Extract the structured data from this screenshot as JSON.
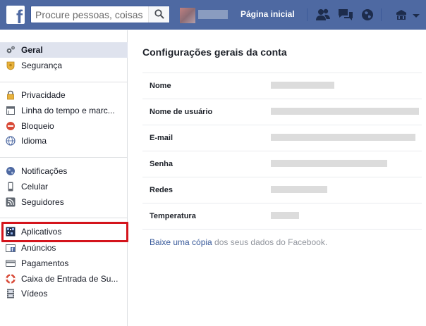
{
  "topbar": {
    "logo_letter": "f",
    "search_placeholder": "Procure pessoas, coisas",
    "home_label": "Página inicial",
    "icons": [
      "friend-requests-icon",
      "messages-icon",
      "notifications-globe-icon",
      "privacy-shortcuts-icon",
      "account-menu-icon"
    ]
  },
  "sidebar": {
    "items": [
      {
        "label": "Geral",
        "icon": "gears-icon",
        "active": true
      },
      {
        "label": "Segurança",
        "icon": "shield-icon"
      },
      {
        "label": "Privacidade",
        "icon": "lock-icon"
      },
      {
        "label": "Linha do tempo e marc...",
        "icon": "timeline-icon"
      },
      {
        "label": "Bloqueio",
        "icon": "block-icon"
      },
      {
        "label": "Idioma",
        "icon": "globe-icon"
      },
      {
        "label": "Notificações",
        "icon": "notification-globe-icon"
      },
      {
        "label": "Celular",
        "icon": "mobile-icon"
      },
      {
        "label": "Seguidores",
        "icon": "rss-icon"
      },
      {
        "label": "Aplicativos",
        "icon": "apps-icon",
        "highlighted": true
      },
      {
        "label": "Anúncios",
        "icon": "ads-icon"
      },
      {
        "label": "Pagamentos",
        "icon": "card-icon"
      },
      {
        "label": "Caixa de Entrada de Su...",
        "icon": "lifebuoy-icon"
      },
      {
        "label": "Vídeos",
        "icon": "film-icon"
      }
    ]
  },
  "main": {
    "title": "Configurações gerais da conta",
    "rows": [
      {
        "label": "Nome"
      },
      {
        "label": "Nome de usuário"
      },
      {
        "label": "E-mail"
      },
      {
        "label": "Senha"
      },
      {
        "label": "Redes"
      },
      {
        "label": "Temperatura"
      }
    ],
    "footer": {
      "link": "Baixe uma cópia",
      "text": " dos seus dados do Facebook."
    }
  },
  "colors": {
    "topbar": "#4e69a2",
    "active_item": "#dfe3ee",
    "highlight": "#d4141c",
    "link": "#365899"
  }
}
